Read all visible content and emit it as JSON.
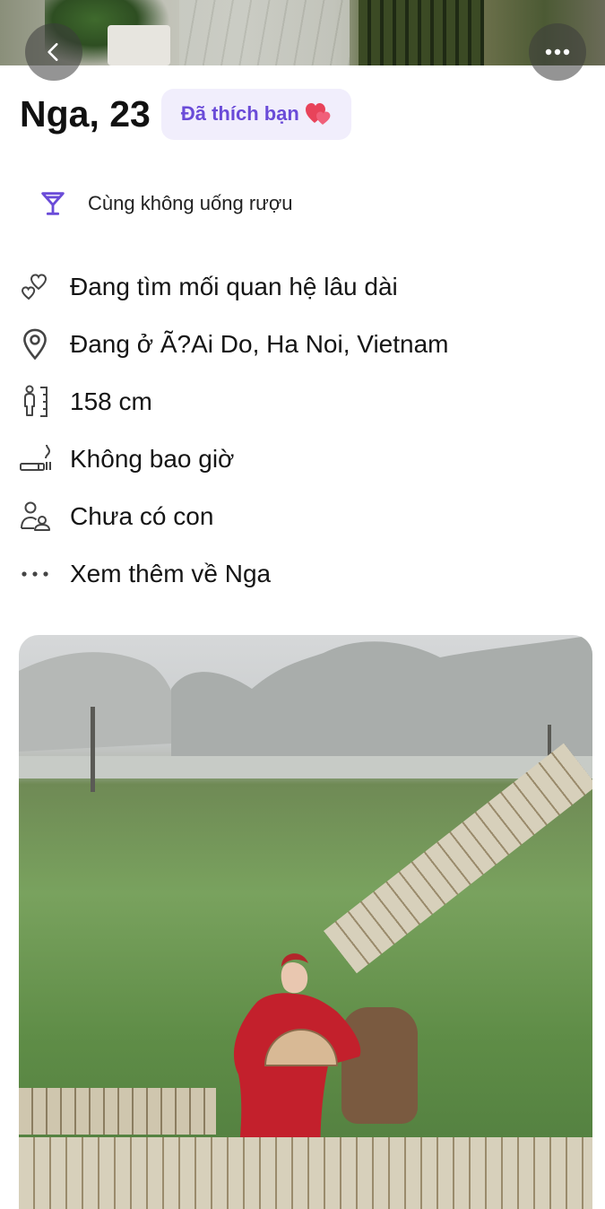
{
  "header": {
    "back_icon": "chevron-left-icon",
    "more_icon": "ellipsis-icon"
  },
  "profile": {
    "name_age": "Nga, 23",
    "liked_badge": "Đã thích bạn",
    "liked_badge_icon": "heart-emoji-icon"
  },
  "common": {
    "icon": "cocktail-glass-icon",
    "text": "Cùng không uống rượu"
  },
  "details": [
    {
      "icon": "hearts-icon",
      "text": "Đang tìm mối quan hệ lâu dài"
    },
    {
      "icon": "location-pin-icon",
      "text": "Đang ở Ã?Ai Do, Ha Noi, Vietnam"
    },
    {
      "icon": "height-icon",
      "text": "158 cm"
    },
    {
      "icon": "smoking-icon",
      "text": "Không bao giờ"
    },
    {
      "icon": "children-icon",
      "text": "Chưa có con"
    },
    {
      "icon": "more-dots-icon",
      "text": "Xem thêm về Nga"
    }
  ],
  "colors": {
    "accent": "#6a4bd8",
    "badge_bg": "#f1eefc",
    "text": "#151515"
  }
}
